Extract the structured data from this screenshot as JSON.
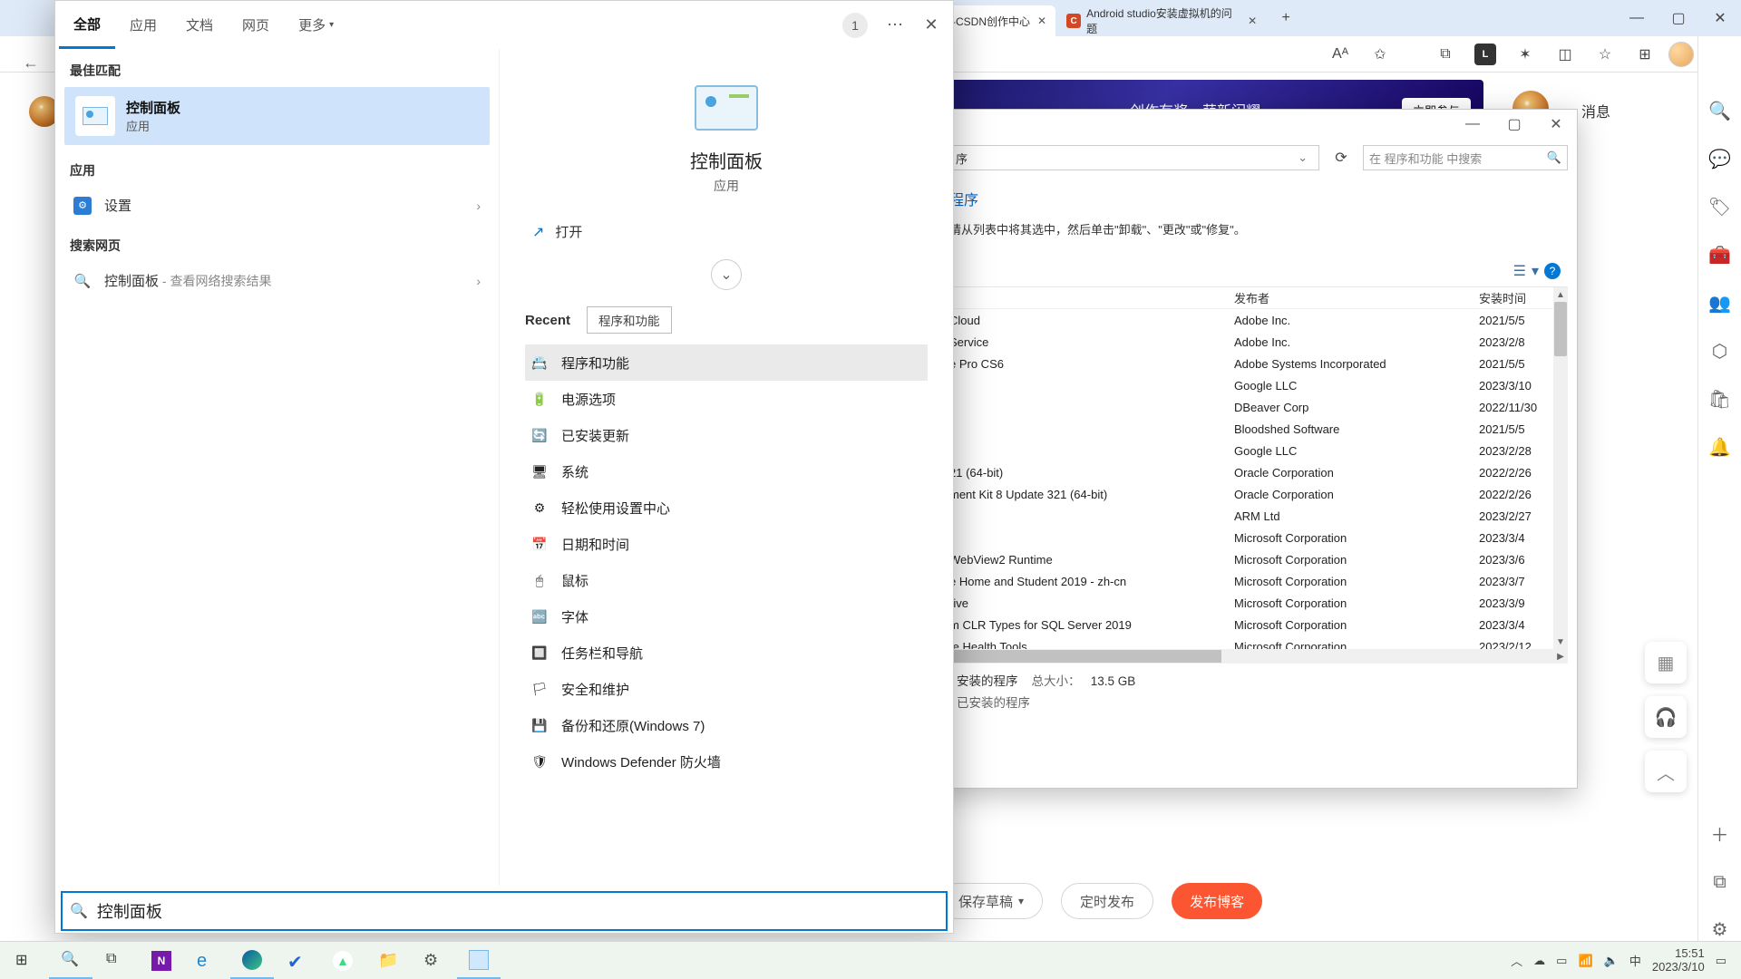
{
  "browser": {
    "tabs": [
      {
        "title": "-CSDN创作中心"
      },
      {
        "title": "Android studio安装虚拟机的问题"
      }
    ],
    "newtab": "+",
    "win": {
      "min": "—",
      "max": "▢",
      "close": "✕"
    },
    "toolbar": {
      "aa": "Aᴬ",
      "star": "✩",
      "collections": "⧉",
      "ext_l": "L",
      "ext_puzzle": "✶",
      "split": "◫",
      "fav": "☆",
      "collections2": "⊞",
      "profile": "👤",
      "more": "⋯"
    },
    "csdn": {
      "banner1": "创作有奖，萌新闪耀，",
      "banner_btn": "立即参与",
      "msg": "消息",
      "save_draft": "保存草稿",
      "schedule": "定时发布",
      "publish": "发布博客"
    }
  },
  "edge_sidebar": [
    "🔍",
    "💬",
    "🏷",
    "🧰",
    "👥",
    "⬡",
    "🛍",
    "🔔",
    "＋",
    "⧉",
    "⚙"
  ],
  "progwin": {
    "addr_text": "序",
    "search_placeholder": "在 程序和功能 中搜索",
    "link": "程序",
    "desc": "请从列表中将其选中，然后单击\"卸载\"、\"更改\"或\"修复\"。",
    "columns": {
      "name": "",
      "publisher": "发布者",
      "date": "安装时间"
    },
    "rows": [
      {
        "name": " Cloud",
        "pub": "Adobe Inc.",
        "date": "2021/5/5"
      },
      {
        "name": " Service",
        "pub": "Adobe Inc.",
        "date": "2023/2/8"
      },
      {
        "name": "e Pro CS6",
        "pub": "Adobe Systems Incorporated",
        "date": "2021/5/5"
      },
      {
        "name": "",
        "pub": "Google LLC",
        "date": "2023/3/10"
      },
      {
        "name": "",
        "pub": "DBeaver Corp",
        "date": "2022/11/30"
      },
      {
        "name": "",
        "pub": "Bloodshed Software",
        "date": "2021/5/5"
      },
      {
        "name": "",
        "pub": "Google LLC",
        "date": "2023/2/28"
      },
      {
        "name": "21 (64-bit)",
        "pub": "Oracle Corporation",
        "date": "2022/2/26"
      },
      {
        "name": "ment Kit 8 Update 321 (64-bit)",
        "pub": "Oracle Corporation",
        "date": "2022/2/26"
      },
      {
        "name": "",
        "pub": "ARM Ltd",
        "date": "2023/2/27"
      },
      {
        "name": "",
        "pub": "Microsoft Corporation",
        "date": "2023/3/4"
      },
      {
        "name": "WebView2 Runtime",
        "pub": "Microsoft Corporation",
        "date": "2023/3/6"
      },
      {
        "name": "e Home and Student 2019 - zh-cn",
        "pub": "Microsoft Corporation",
        "date": "2023/3/7"
      },
      {
        "name": "rive",
        "pub": "Microsoft Corporation",
        "date": "2023/3/9"
      },
      {
        "name": "m CLR Types for SQL Server 2019",
        "pub": "Microsoft Corporation",
        "date": "2023/3/4"
      },
      {
        "name": "te Health Tools",
        "pub": "Microsoft Corporation",
        "date": "2023/2/12"
      }
    ],
    "status1": "安装的程序",
    "status_size_lbl": "总大小：",
    "status_size": "13.5 GB",
    "status2": "已安装的程序"
  },
  "search": {
    "tabs": {
      "all": "全部",
      "apps": "应用",
      "docs": "文档",
      "web": "网页",
      "more": "更多"
    },
    "badge": "1",
    "groups": {
      "best": "最佳匹配",
      "apps": "应用",
      "web": "搜索网页"
    },
    "best_match": {
      "title": "控制面板",
      "sub": "应用"
    },
    "app_item": "设置",
    "web_item_prefix": "控制面板",
    "web_item_suffix": " - 查看网络搜索结果",
    "right": {
      "title": "控制面板",
      "sub": "应用",
      "open": "打开"
    },
    "recent_label": "Recent",
    "recent_chip": "程序和功能",
    "recent_items": [
      {
        "icon": "📇",
        "label": "程序和功能"
      },
      {
        "icon": "🔋",
        "label": "电源选项"
      },
      {
        "icon": "🔄",
        "label": "已安装更新"
      },
      {
        "icon": "🖥",
        "label": "系统"
      },
      {
        "icon": "⚙",
        "label": "轻松使用设置中心"
      },
      {
        "icon": "📅",
        "label": "日期和时间"
      },
      {
        "icon": "🖱",
        "label": "鼠标"
      },
      {
        "icon": "🔤",
        "label": "字体"
      },
      {
        "icon": "🔲",
        "label": "任务栏和导航"
      },
      {
        "icon": "🏳",
        "label": "安全和维护"
      },
      {
        "icon": "💾",
        "label": "备份和还原(Windows 7)"
      },
      {
        "icon": "🛡",
        "label": "Windows Defender 防火墙"
      }
    ],
    "input_value": "控制面板"
  },
  "taskbar": {
    "tray": {
      "ime": "中",
      "time": "15:51",
      "date": "2023/3/10"
    }
  }
}
